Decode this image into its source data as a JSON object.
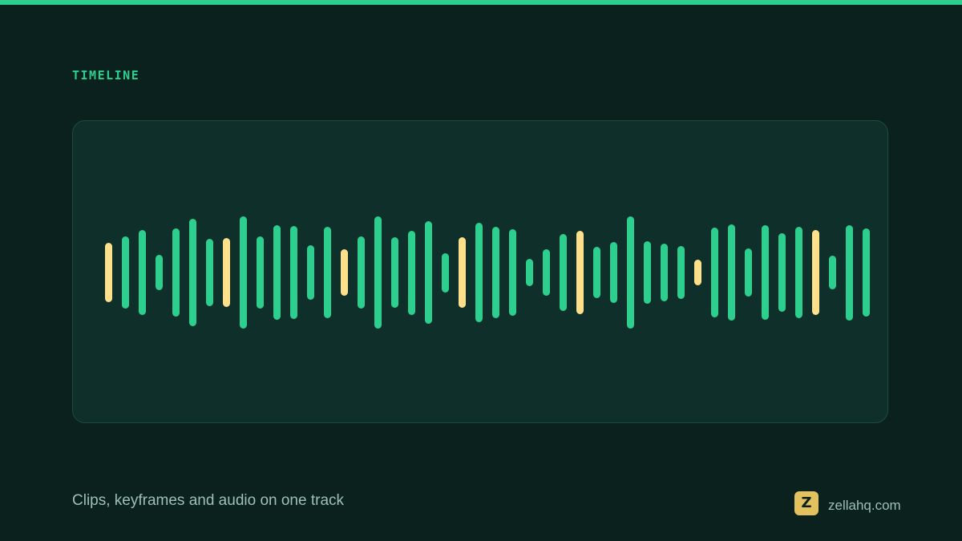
{
  "header": {
    "section_label": "TIMELINE"
  },
  "timeline": {
    "colors": {
      "audio": "#2ccf8e",
      "marker": "#ffe08a",
      "accent_bar": "#2ccf8e",
      "panel_bg": "#0f302a",
      "page_bg": "#0a211d"
    },
    "waveform": [
      {
        "level": 0.53,
        "kind": "marker"
      },
      {
        "level": 0.64,
        "kind": "audio"
      },
      {
        "level": 0.76,
        "kind": "audio"
      },
      {
        "level": 0.32,
        "kind": "audio"
      },
      {
        "level": 0.79,
        "kind": "audio"
      },
      {
        "level": 0.96,
        "kind": "audio"
      },
      {
        "level": 0.6,
        "kind": "audio"
      },
      {
        "level": 0.61,
        "kind": "marker"
      },
      {
        "level": 1.0,
        "kind": "audio"
      },
      {
        "level": 0.64,
        "kind": "audio"
      },
      {
        "level": 0.84,
        "kind": "audio"
      },
      {
        "level": 0.83,
        "kind": "audio"
      },
      {
        "level": 0.49,
        "kind": "audio"
      },
      {
        "level": 0.81,
        "kind": "audio"
      },
      {
        "level": 0.41,
        "kind": "marker"
      },
      {
        "level": 0.64,
        "kind": "audio"
      },
      {
        "level": 1.0,
        "kind": "audio"
      },
      {
        "level": 0.63,
        "kind": "audio"
      },
      {
        "level": 0.75,
        "kind": "audio"
      },
      {
        "level": 0.91,
        "kind": "audio"
      },
      {
        "level": 0.35,
        "kind": "audio"
      },
      {
        "level": 0.63,
        "kind": "marker"
      },
      {
        "level": 0.89,
        "kind": "audio"
      },
      {
        "level": 0.81,
        "kind": "audio"
      },
      {
        "level": 0.77,
        "kind": "audio"
      },
      {
        "level": 0.24,
        "kind": "audio"
      },
      {
        "level": 0.41,
        "kind": "audio"
      },
      {
        "level": 0.69,
        "kind": "audio"
      },
      {
        "level": 0.74,
        "kind": "marker"
      },
      {
        "level": 0.46,
        "kind": "audio"
      },
      {
        "level": 0.54,
        "kind": "audio"
      },
      {
        "level": 1.0,
        "kind": "audio"
      },
      {
        "level": 0.56,
        "kind": "audio"
      },
      {
        "level": 0.51,
        "kind": "audio"
      },
      {
        "level": 0.47,
        "kind": "audio"
      },
      {
        "level": 0.23,
        "kind": "marker"
      },
      {
        "level": 0.8,
        "kind": "audio"
      },
      {
        "level": 0.86,
        "kind": "audio"
      },
      {
        "level": 0.43,
        "kind": "audio"
      },
      {
        "level": 0.84,
        "kind": "audio"
      },
      {
        "level": 0.7,
        "kind": "audio"
      },
      {
        "level": 0.81,
        "kind": "audio"
      },
      {
        "level": 0.76,
        "kind": "marker"
      },
      {
        "level": 0.3,
        "kind": "audio"
      },
      {
        "level": 0.85,
        "kind": "audio"
      },
      {
        "level": 0.79,
        "kind": "audio"
      }
    ]
  },
  "footer": {
    "caption": "Clips, keyframes and audio on one track",
    "brand": {
      "logo_letter": "Z",
      "logo_color": "#e3c15e",
      "site": "zellahq.com"
    }
  }
}
